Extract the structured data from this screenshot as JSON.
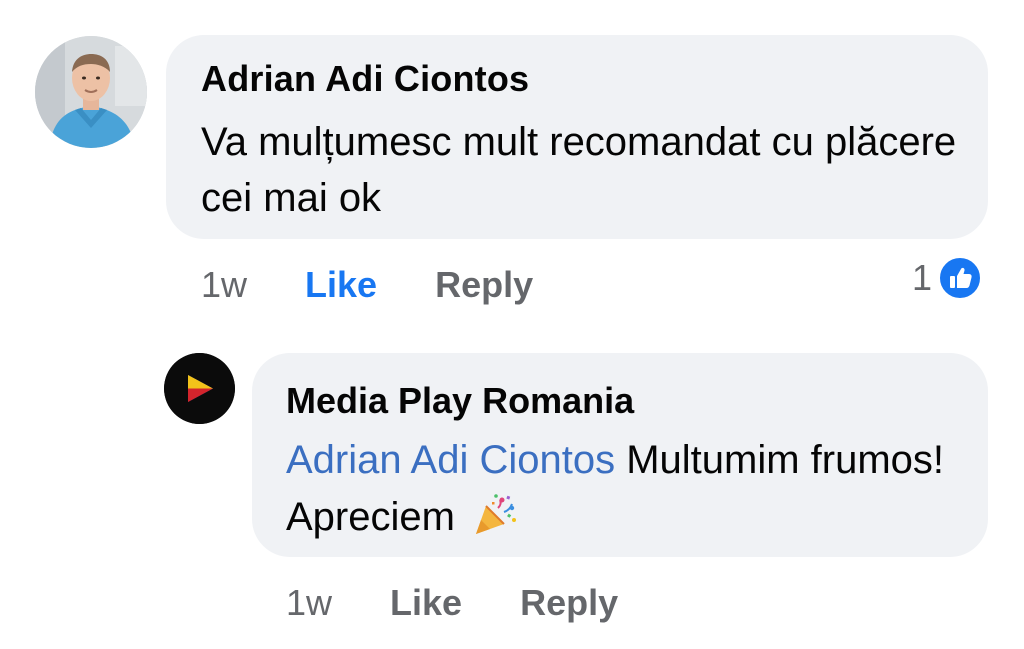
{
  "comments": [
    {
      "author": "Adrian Adi Ciontos",
      "text": "Va mulțumesc mult recomandat cu plăcere cei mai ok",
      "time": "1w",
      "like_label": "Like",
      "reply_label": "Reply",
      "reaction_count": "1",
      "reaction_icon": "thumbs-up-icon",
      "liked": true
    },
    {
      "author": "Media Play Romania",
      "mention": "Adrian Adi Ciontos",
      "text": " Multumim frumos! Apreciem",
      "emoji": "party-popper-icon",
      "time": "1w",
      "like_label": "Like",
      "reply_label": "Reply",
      "liked": false
    }
  ],
  "colors": {
    "bubble": "#f0f2f5",
    "like_active": "#1877f2",
    "mention": "#3b6fc1",
    "muted": "#65676b"
  }
}
